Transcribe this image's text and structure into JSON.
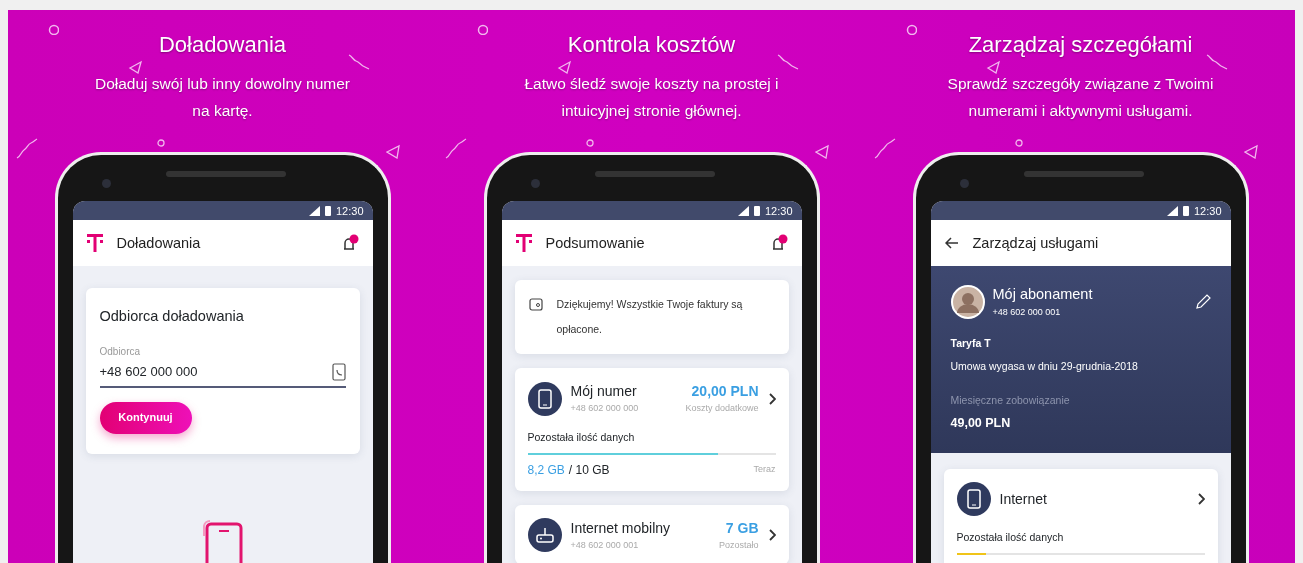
{
  "panels": [
    {
      "title": "Doładowania",
      "subtitle": [
        "Doładuj swój lub inny dowolny numer",
        "na kartę."
      ],
      "screen": {
        "kind": "topup",
        "time": "12:30",
        "header": {
          "back": false,
          "title": "Doładowania",
          "bell": true
        },
        "card": {
          "title": "Odbiorca doładowania",
          "field_label": "Odbiorca",
          "field_value": "+48 602 000 000",
          "button": "Kontynuuj"
        }
      }
    },
    {
      "title": "Kontrola kosztów",
      "subtitle": [
        "Łatwo śledź swoje koszty na prostej i",
        "intuicyjnej stronie głównej."
      ],
      "screen": {
        "kind": "summary",
        "time": "12:30",
        "header": {
          "back": false,
          "title": "Podsumowanie",
          "bell": true
        },
        "notice": "Dziękujemy! Wszystkie Twoje faktury są opłacone.",
        "lines": [
          {
            "kind": "number",
            "name": "Mój numer",
            "number": "+48 602 000 000",
            "amount": "20,00 PLN",
            "amount_label": "Koszty dodatkowe",
            "usage": {
              "label": "Pozostała ilość danych",
              "used": "8,2 GB",
              "total": "/ 10 GB",
              "note": "Teraz",
              "level": 0.77,
              "color": "#5fcfdc"
            }
          },
          {
            "kind": "internet",
            "name": "Internet mobilny",
            "number": "+48 602 000 001",
            "amount": "7 GB",
            "amount_label": "Pozostało"
          }
        ]
      }
    },
    {
      "title": "Zarządzaj szczegółami",
      "subtitle": [
        "Sprawdź szczegóły związane z Twoimi",
        "numerami i aktywnymi usługami."
      ],
      "screen": {
        "kind": "details",
        "time": "12:30",
        "header": {
          "back": true,
          "title": "Zarządzaj usługami",
          "bell": false
        },
        "plan": {
          "name": "Mój abonament",
          "number": "+48 602 000 001",
          "tariff": "Taryfa T",
          "contract": "Umowa wygasa w dniu 29-grudnia-2018",
          "commitment_label": "Miesięczne zobowiązanie",
          "commitment": "49,00 PLN"
        },
        "services": [
          {
            "name": "Internet",
            "usage": {
              "label": "Pozostała ilość danych",
              "level": 0.12,
              "color": "#f0c419"
            }
          }
        ]
      }
    }
  ]
}
